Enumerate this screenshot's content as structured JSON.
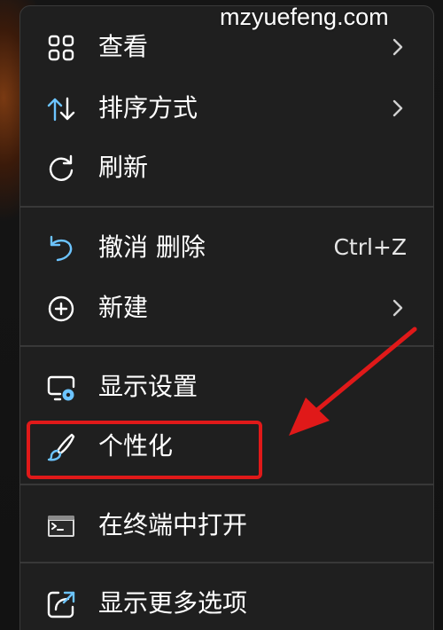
{
  "watermark": "mzyuefeng.com",
  "colors": {
    "menu_background": "#1f1f1f",
    "text": "#ffffff",
    "accent_icon": "#6cc4ff",
    "annotation_red": "#e01919"
  },
  "menu": {
    "items": [
      {
        "label": "查看",
        "icon": "grid-view-icon",
        "has_submenu": true
      },
      {
        "label": "排序方式",
        "icon": "sort-arrows-icon",
        "has_submenu": true
      },
      {
        "label": "刷新",
        "icon": "refresh-icon",
        "has_submenu": false
      },
      {
        "label": "撤消 删除",
        "icon": "undo-icon",
        "shortcut": "Ctrl+Z",
        "has_submenu": false
      },
      {
        "label": "新建",
        "icon": "add-circle-icon",
        "has_submenu": true
      },
      {
        "label": "显示设置",
        "icon": "display-settings-icon",
        "has_submenu": false
      },
      {
        "label": "个性化",
        "icon": "paintbrush-icon",
        "has_submenu": false,
        "highlighted": true
      },
      {
        "label": "在终端中打开",
        "icon": "terminal-icon",
        "has_submenu": false
      },
      {
        "label": "显示更多选项",
        "icon": "share-open-icon",
        "has_submenu": false
      }
    ]
  }
}
